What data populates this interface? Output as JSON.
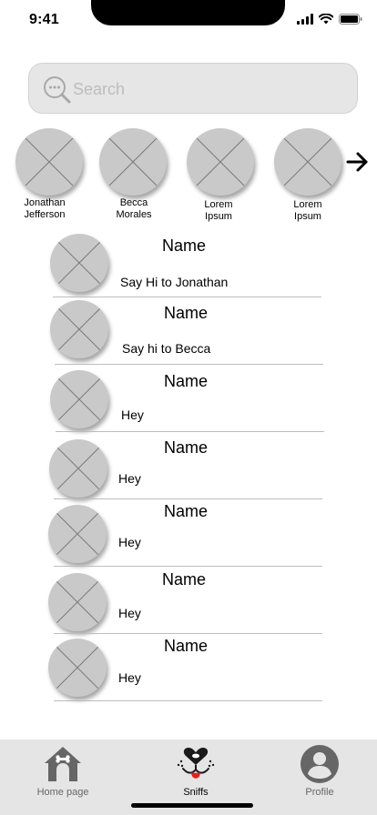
{
  "status_bar": {
    "time": "9:41"
  },
  "search": {
    "placeholder": "Search",
    "value": ""
  },
  "stories": [
    {
      "name": "Jonathan Jefferson"
    },
    {
      "name": "Becca Morales"
    },
    {
      "name": "Lorem Ipsum"
    },
    {
      "name": "Lorem Ipsum"
    }
  ],
  "chats": [
    {
      "name": "Name",
      "message": "Say Hi to Jonathan"
    },
    {
      "name": "Name",
      "message": "Say hi to Becca"
    },
    {
      "name": "Name",
      "message": "Hey"
    },
    {
      "name": "Name",
      "message": "Hey"
    },
    {
      "name": "Name",
      "message": "Hey"
    },
    {
      "name": "Name",
      "message": "Hey"
    },
    {
      "name": "Name",
      "message": "Hey"
    }
  ],
  "tabs": [
    {
      "label": "Home page",
      "icon": "doghouse-icon"
    },
    {
      "label": "Sniffs",
      "icon": "dog-nose-icon",
      "active": true
    },
    {
      "label": "Profile",
      "icon": "user-icon"
    }
  ],
  "colors": {
    "avatar_placeholder": "#c9c9c9",
    "tab_bar": "#e5e5e5",
    "search_bg": "#e6e6e6",
    "nose_tongue": "#e02020"
  }
}
